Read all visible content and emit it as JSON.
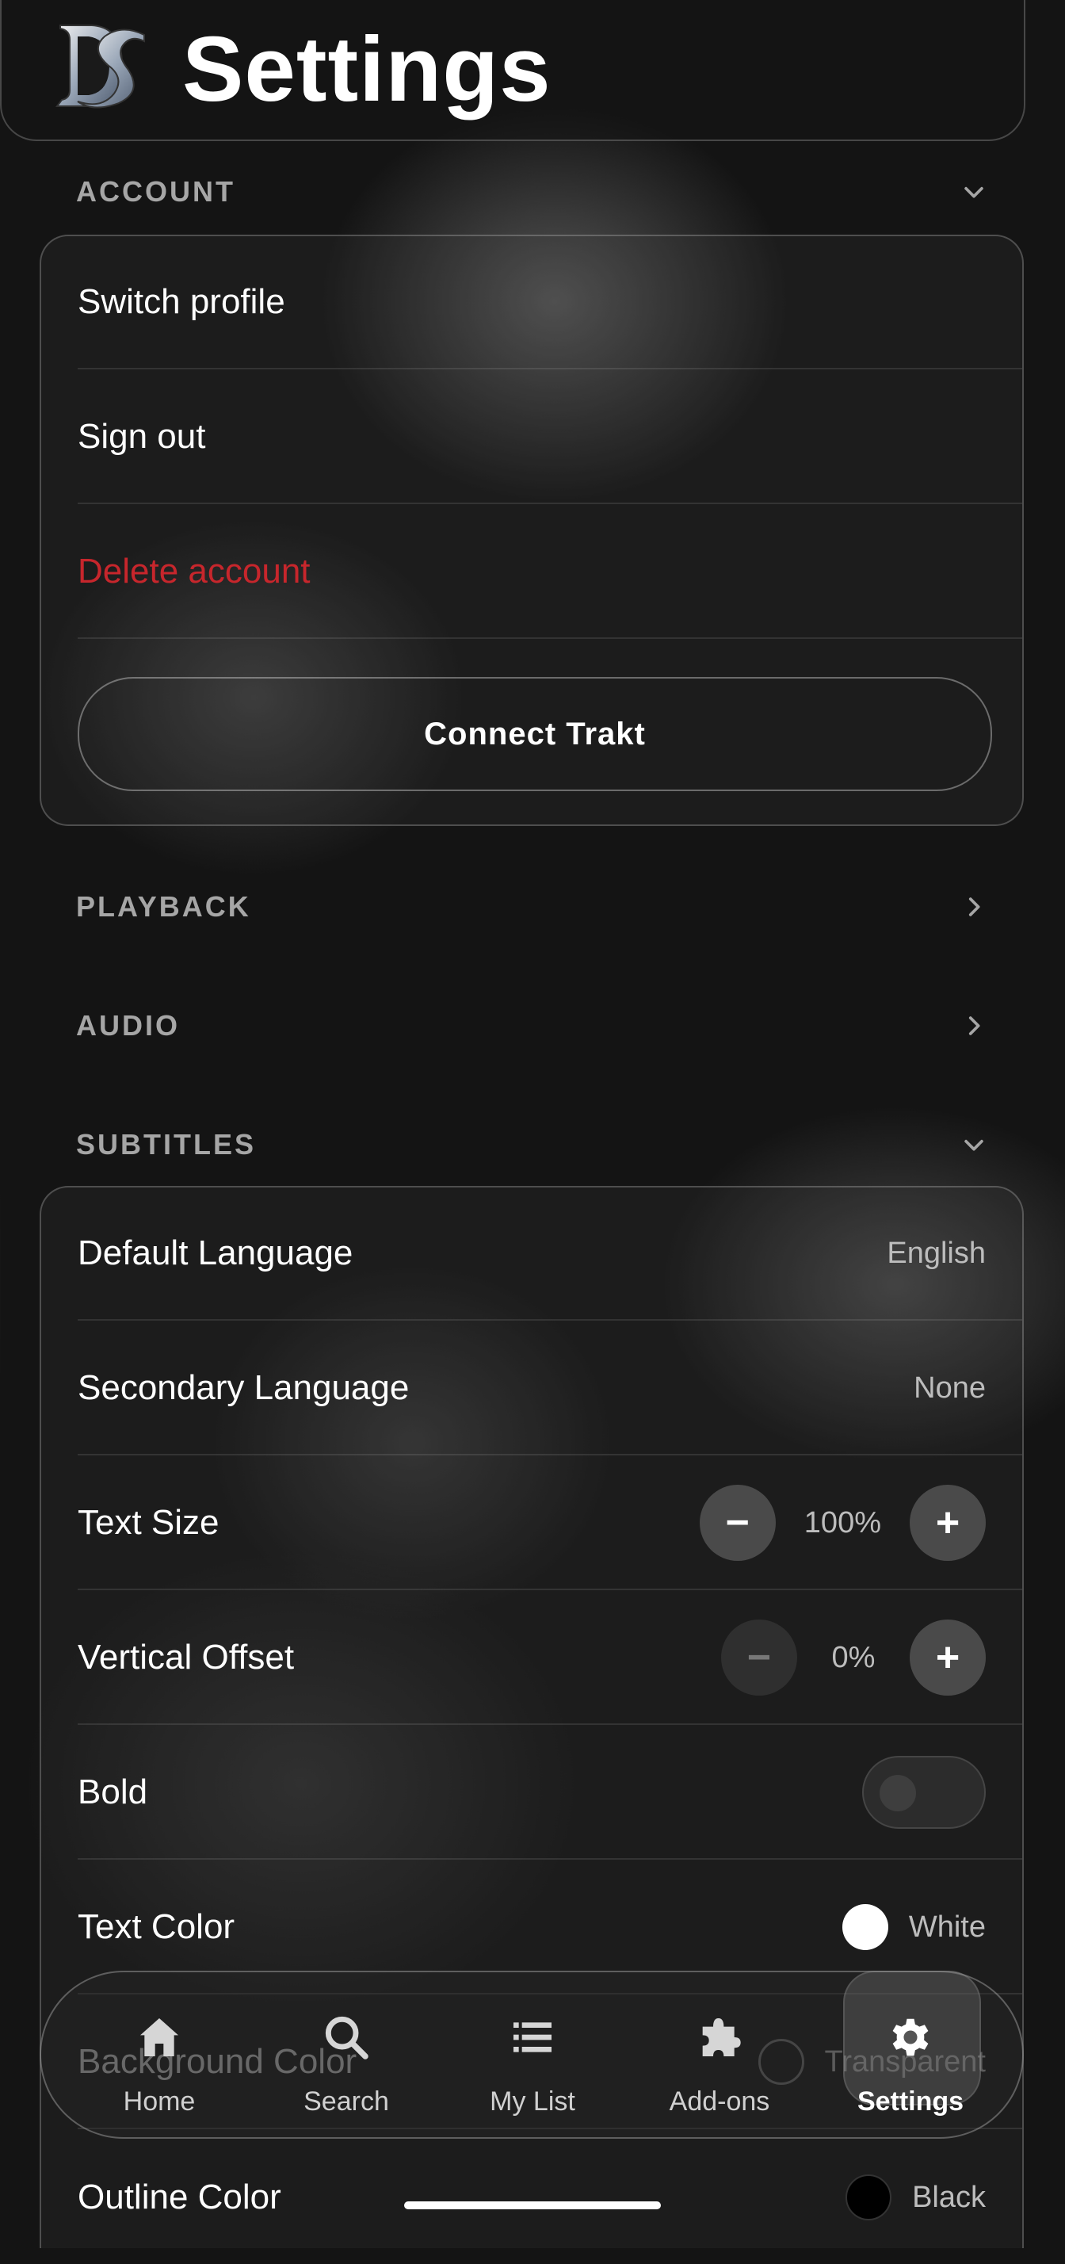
{
  "header": {
    "title": "Settings",
    "logo_text": "DS"
  },
  "sections": {
    "account": {
      "title": "ACCOUNT",
      "expanded": true
    },
    "playback": {
      "title": "PLAYBACK",
      "expanded": false
    },
    "audio": {
      "title": "AUDIO",
      "expanded": false
    },
    "subtitles": {
      "title": "SUBTITLES",
      "expanded": true
    }
  },
  "account": {
    "switch_profile": "Switch profile",
    "sign_out": "Sign out",
    "delete_account": "Delete account",
    "connect_trakt": "Connect Trakt"
  },
  "subtitles": {
    "default_language": {
      "label": "Default Language",
      "value": "English"
    },
    "secondary_language": {
      "label": "Secondary Language",
      "value": "None"
    },
    "text_size": {
      "label": "Text Size",
      "value": "100%",
      "minus": "−",
      "plus": "+"
    },
    "vertical_offset": {
      "label": "Vertical Offset",
      "value": "0%",
      "minus": "−",
      "plus": "+"
    },
    "bold": {
      "label": "Bold",
      "enabled": false
    },
    "text_color": {
      "label": "Text Color",
      "value": "White",
      "swatch": "#ffffff"
    },
    "background_color": {
      "label": "Background Color",
      "value": "Transparent",
      "swatch": "transparent"
    },
    "outline_color": {
      "label": "Outline Color",
      "value": "Black",
      "swatch": "#000000"
    }
  },
  "tabbar": {
    "active": "settings",
    "items": [
      {
        "id": "home",
        "label": "Home",
        "icon": "home-icon"
      },
      {
        "id": "search",
        "label": "Search",
        "icon": "search-icon"
      },
      {
        "id": "mylist",
        "label": "My List",
        "icon": "list-icon"
      },
      {
        "id": "addons",
        "label": "Add-ons",
        "icon": "puzzle-icon"
      },
      {
        "id": "settings",
        "label": "Settings",
        "icon": "gear-icon"
      }
    ]
  },
  "colors": {
    "danger": "#c7262c",
    "section_title": "#a6a6a6"
  }
}
